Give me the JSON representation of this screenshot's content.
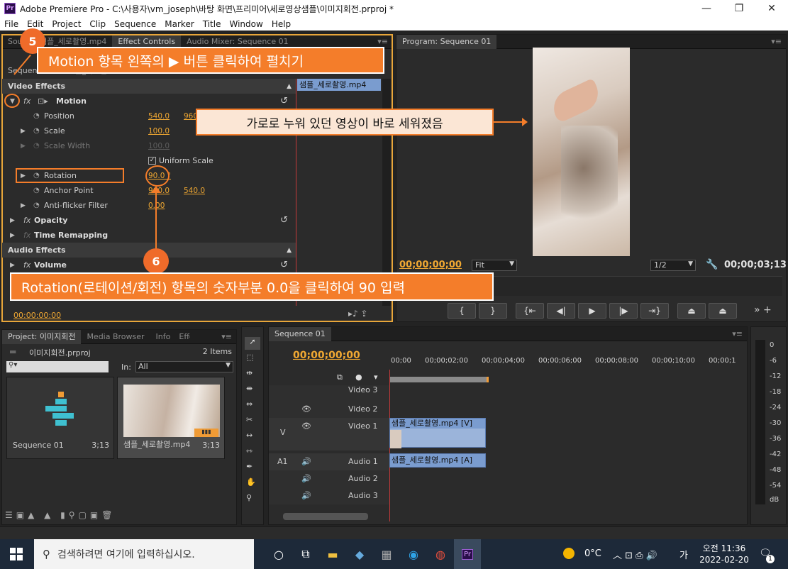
{
  "app": {
    "logo": "Pr",
    "window_title": "Adobe Premiere Pro - C:\\사용자\\vm_joseph\\바탕 화면\\프리미어\\세로영상샘플\\이미지회전.prproj *",
    "menu": [
      "File",
      "Edit",
      "Project",
      "Clip",
      "Sequence",
      "Marker",
      "Title",
      "Window",
      "Help"
    ]
  },
  "effect_controls": {
    "tabs": [
      "Source: 샘플_세로촬영.mp4",
      "Effect Controls",
      "Audio Mixer: Sequence 01"
    ],
    "source_label": "Sequence 01 * 샘플_세로촬영.mp4",
    "clip_name": "샘플_세로촬영.mp4",
    "video_effects": "Video Effects",
    "motion": "Motion",
    "position_label": "Position",
    "position_x": "540.0",
    "position_y": "960.0",
    "scale_label": "Scale",
    "scale_value": "100.0",
    "scale_width_label": "Scale Width",
    "scale_width_value": "100.0",
    "uniform_scale": "Uniform Scale",
    "rotation_label": "Rotation",
    "rotation_value": "90.0 °",
    "anchor_label": "Anchor Point",
    "anchor_x": "960.0",
    "anchor_y": "540.0",
    "antiflicker_label": "Anti-flicker Filter",
    "antiflicker_value": "0.00",
    "opacity": "Opacity",
    "time_remap": "Time Remapping",
    "audio_effects": "Audio Effects",
    "volume": "Volume",
    "timecode": "00:00:00:00"
  },
  "program": {
    "tab": "Program: Sequence 01",
    "timecode_left": "00;00;00;00",
    "fit": "Fit",
    "resolution": "1/2",
    "timecode_right": "00;00;03;13"
  },
  "project": {
    "tabs": [
      "Project: 이미지회전",
      "Media Browser",
      "Info",
      "Effects"
    ],
    "file": "이미지회전.prproj",
    "count": "2 Items",
    "in_label": "In:",
    "in_value": "All",
    "items": [
      {
        "name": "Sequence 01",
        "duration": "3;13"
      },
      {
        "name": "샘플_세로촬영.mp4",
        "duration": "3;13"
      }
    ]
  },
  "timeline": {
    "tab": "Sequence 01",
    "timecode": "00;00;00;00",
    "ruler": [
      "00;00",
      "00;00;02;00",
      "00;00;04;00",
      "00;00;06;00",
      "00;00;08;00",
      "00;00;10;00",
      "00;00;1"
    ],
    "tracks": [
      "Video 3",
      "Video 2",
      "Video 1",
      "Audio 1",
      "Audio 2",
      "Audio 3"
    ],
    "v_label": "V",
    "a_label": "A1",
    "video_clip": "샘플_세로촬영.mp4 [V]",
    "audio_clip": "샘플_세로촬영.mp4 [A]"
  },
  "meter": {
    "labels": [
      "0",
      "-6",
      "-12",
      "-18",
      "-24",
      "-30",
      "-36",
      "-42",
      "-48",
      "-54",
      "dB"
    ]
  },
  "callouts": {
    "step5_num": "5",
    "step5_text": "Motion 항목 왼쪽의 ▶ 버튼 클릭하여 펼치기",
    "note_text": "가로로 누워 있던 영상이 바로 세워졌음",
    "step6_num": "6",
    "step6_text": "Rotation(로테이션/회전) 항목의 숫자부분 0.0을 클릭하여 90 입력"
  },
  "taskbar": {
    "search_placeholder": "검색하려면 여기에 입력하십시오.",
    "weather": "0°C",
    "ime": "가",
    "time": "오전 11:36",
    "date": "2022-02-20",
    "notification_count": "1"
  },
  "colors": {
    "accent_orange": "#f47d2a",
    "value_orange": "#f0a832",
    "panel_bg": "#2b2b2b",
    "clip_blue": "#7a9ccf"
  }
}
